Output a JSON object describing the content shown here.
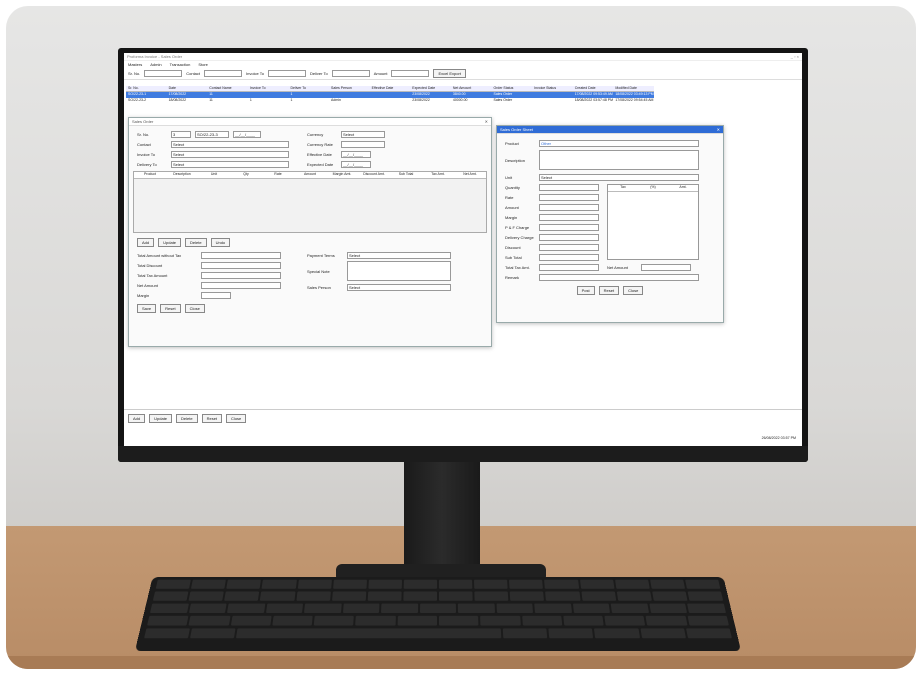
{
  "app": {
    "title": "Proforma Invoice - Sales Order",
    "window_controls": "_ ▫ ×"
  },
  "menu": [
    "Masters",
    "Admin",
    "Transaction",
    "Store"
  ],
  "filters": {
    "items": [
      {
        "label": "Sr. No."
      },
      {
        "label": "Contact"
      },
      {
        "label": "Invoice To"
      },
      {
        "label": "Deliver To"
      },
      {
        "label": "Amount"
      }
    ],
    "export_label": "Excel Export"
  },
  "grid": {
    "headers": [
      "Sr. No.",
      "Date",
      "Contact Name",
      "Invoice To",
      "Deliver To",
      "Sales Person",
      "Effective Date",
      "Expected Date",
      "Net Amount",
      "Order Status",
      "Invoice Status",
      "Created Date",
      "Modified Date"
    ],
    "rows": [
      [
        "SO/22-23-1",
        "17/08/2022",
        "11",
        "",
        "1",
        "",
        "",
        "23/08/2022",
        "3840.00",
        "Sales Order",
        "",
        "17/08/2022 09:53:49 AM",
        "18/08/2022 03:49:13 PM"
      ],
      [
        "SO/22-23-2",
        "18/08/2022",
        "11",
        "1",
        "1",
        "Admin",
        "",
        "23/08/2022",
        "40000.00",
        "Sales Order",
        "",
        "18/08/2022 03:57:48 PM",
        "17/08/2022 09:54:45 AM"
      ]
    ]
  },
  "sales_order": {
    "title": "Sales Order",
    "labels": {
      "sr_no": "Sr. No.",
      "contact": "Contact",
      "invoice_to": "Invoice To",
      "delivery_to": "Delivery To",
      "currency": "Currency",
      "currency_rate": "Currency Rate",
      "effective_date": "Effective Date",
      "expected_date": "Expected Date"
    },
    "values": {
      "sr_no": "3",
      "sr_no_code": "SO/22-23-3",
      "date": "__/__/____",
      "select": "Select"
    },
    "item_headers": [
      "Product",
      "Description",
      "Unit",
      "Qty",
      "Rate",
      "Amount",
      "Margin Amt.",
      "Discount Amt.",
      "Sub Total",
      "Tax Amt.",
      "Net Amt."
    ],
    "item_buttons": [
      "Add",
      "Update",
      "Delete",
      "Undo"
    ],
    "totals": [
      "Total Amount without Tax",
      "Total Discount",
      "Total Tax Amount",
      "Net Amount",
      "Margin"
    ],
    "payment_terms": "Payment Terms",
    "special_note": "Special Note",
    "sales_person": "Sales Person",
    "buttons": [
      "Save",
      "Reset",
      "Close"
    ]
  },
  "item_sheet": {
    "title": "Sales Order Sheet",
    "labels": [
      "Product",
      "Description",
      "Unit",
      "Quantity",
      "Rate",
      "Amount",
      "Margin",
      "P & F Charge",
      "Delivery Charge",
      "Discount",
      "Sub Total",
      "Total Tax Amt.",
      "Remark"
    ],
    "product_value": "Other",
    "unit_value": "Select",
    "tax_headers": [
      "Tax",
      "(%)",
      "Amt."
    ],
    "net_amount": "Net Amount",
    "buttons": [
      "Post",
      "Reset",
      "Close"
    ]
  },
  "bottom_buttons": [
    "Add",
    "Update",
    "Delete",
    "Reset",
    "Close"
  ],
  "statusbar": {
    "datetime": "26/08/2022 03:57 PM"
  }
}
